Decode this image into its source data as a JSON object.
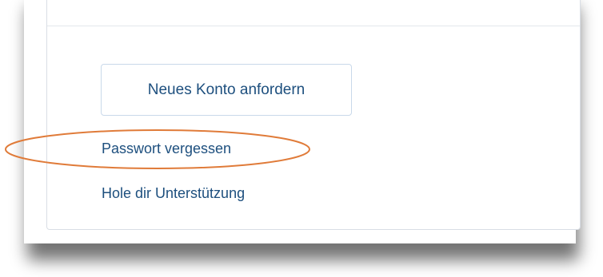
{
  "login_links": {
    "request_account_label": "Neues Konto anfordern",
    "forgot_password_label": "Passwort vergessen",
    "get_support_label": "Hole dir Unterstützung"
  },
  "annotation": {
    "highlight_color": "#e07b39",
    "highlighted_item": "Passwort vergessen"
  },
  "colors": {
    "link_text": "#1d4f7e",
    "button_border": "#c9d9ea",
    "card_border": "#d9dee5"
  }
}
